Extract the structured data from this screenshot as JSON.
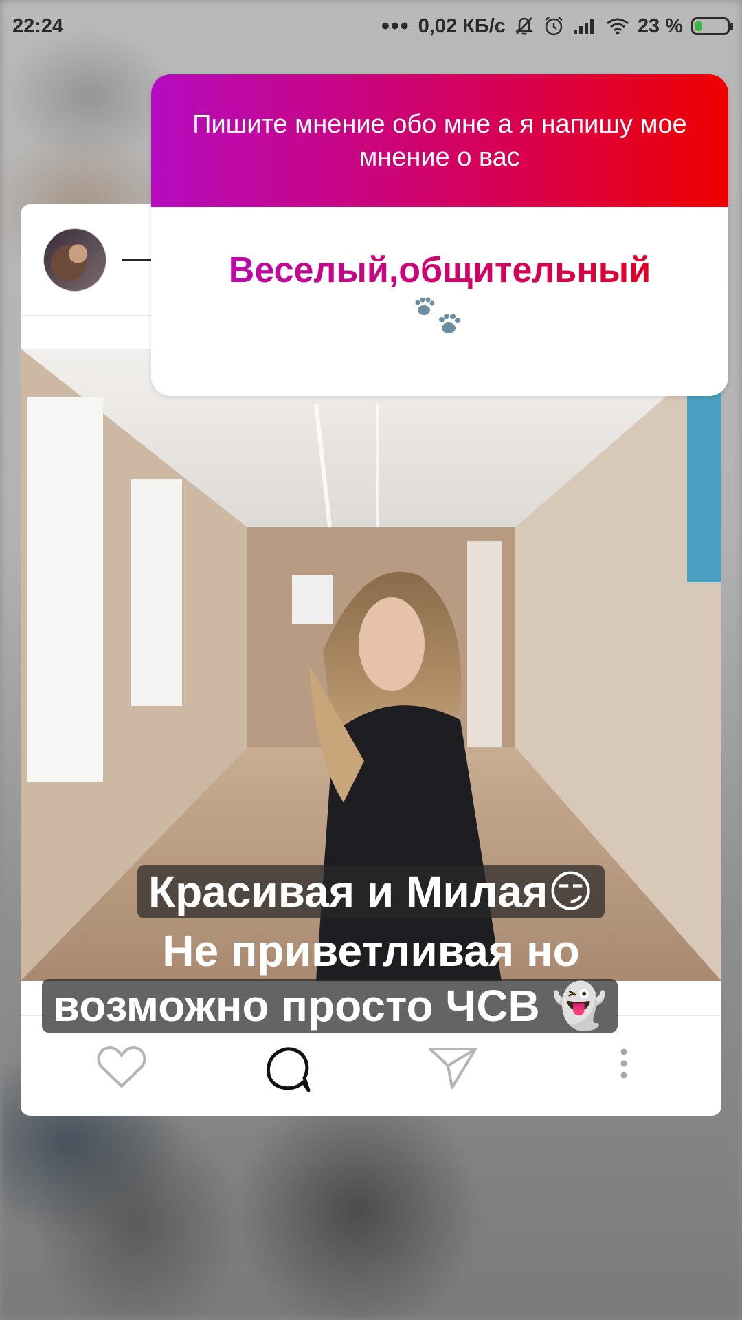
{
  "status_bar": {
    "time": "22:24",
    "dots": "•••",
    "network_speed": "0,02 КБ/с",
    "battery_text": "23 %",
    "battery_level": 0.23,
    "icons": [
      "mute-icon",
      "alarm-icon",
      "signal-icon",
      "wifi-icon",
      "battery-icon"
    ]
  },
  "question_sticker": {
    "question": "Пишите мнение обо мне а я напишу мое мнение о вас",
    "answer": "Веселый,общительный",
    "answer_emoji": "paw-prints-icon",
    "colors": {
      "gradient_start": "#b50bbf",
      "gradient_mid": "#d9004c",
      "gradient_end": "#ef0000"
    }
  },
  "caption": {
    "line1": "Красивая и Милая😏",
    "line2": "Не приветливая но",
    "line3": "возможно просто ЧСВ 👻"
  },
  "post_actions": {
    "icons": [
      "heart-icon",
      "comment-icon",
      "share-icon",
      "more-icon"
    ]
  }
}
